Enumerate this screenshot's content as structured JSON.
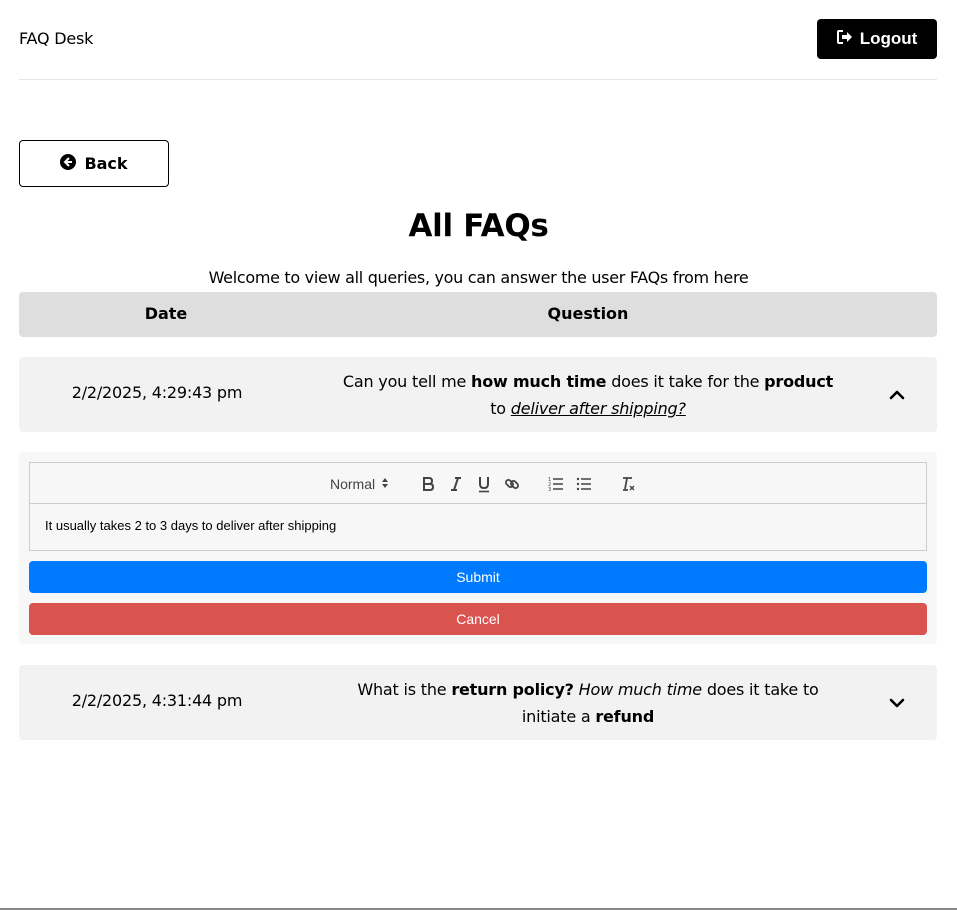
{
  "header": {
    "brand": "FAQ Desk",
    "logout_label": "Logout"
  },
  "back_label": "Back",
  "page": {
    "title": "All FAQs",
    "subtitle": "Welcome to view all queries, you can answer the user FAQs from here"
  },
  "table": {
    "columns": [
      "Date",
      "Question"
    ]
  },
  "faqs": [
    {
      "date": "2/2/2025, 4:29:43 pm",
      "expanded": true,
      "question": {
        "p1": "Can you tell me ",
        "b1": "how much time",
        "p2": " does it take for the ",
        "b2": "product",
        "p3": "to ",
        "ui1": "deliver after shipping?"
      }
    },
    {
      "date": "2/2/2025, 4:31:44 pm",
      "expanded": false,
      "question": {
        "p1": "What is the ",
        "b1": "return policy?",
        "p2": " ",
        "i1": "How much time",
        "p3": " does it take to",
        "p4": "initiate a ",
        "b2": "refund"
      }
    }
  ],
  "editor": {
    "format_select": "Normal",
    "content": "It usually takes 2 to 3 days to deliver after shipping",
    "toolbar_icons": [
      "bold-icon",
      "italic-icon",
      "underline-icon",
      "link-icon",
      "ordered-list-icon",
      "bullet-list-icon",
      "clear-format-icon"
    ]
  },
  "actions": {
    "submit_label": "Submit",
    "cancel_label": "Cancel"
  },
  "colors": {
    "submit": "#007bff",
    "cancel": "#d9534f",
    "row_bg": "#f2f2f2",
    "header_bg": "#dedede"
  }
}
